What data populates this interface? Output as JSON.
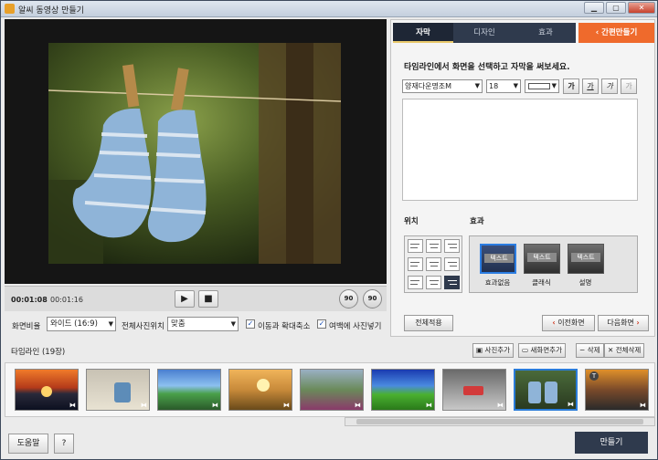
{
  "window": {
    "title": "알씨 동영상 만들기"
  },
  "controls": {
    "current_time": "00:01:08",
    "total_time": "00:01:16",
    "play": "▶",
    "stop": "■",
    "rotate_left": "90",
    "rotate_right": "90"
  },
  "options": {
    "ratio_label": "화면비율",
    "ratio_value": "와이드 (16:9)",
    "photo_pos_label": "전체사진위치",
    "photo_pos_value": "맞춤",
    "move_zoom_label": "이동과 확대축소",
    "margin_label": "여백에 사진넣기"
  },
  "panel": {
    "tabs": [
      "자막",
      "디자인",
      "효과"
    ],
    "quick_button": "간편만들기",
    "hint": "타임라인에서 화면을 선택하고 자막을 써보세요.",
    "font_value": "양재다운명조M",
    "size_value": "18",
    "style_buttons": [
      "가",
      "가",
      "가",
      "가"
    ],
    "position_label": "위치",
    "effect_label": "효과",
    "effects": [
      {
        "thumb": "텍스트",
        "label": "효과없음"
      },
      {
        "thumb": "텍스트",
        "label": "클래식"
      },
      {
        "thumb": "텍스트",
        "label": "설명"
      }
    ],
    "apply_all": "전체적용",
    "prev_scene": "이전화면",
    "next_scene": "다음화면"
  },
  "timeline": {
    "title": "타임라인 (19장)",
    "add_photo": "사진추가",
    "new_scene": "새화면추가",
    "delete": "삭제",
    "delete_all": "전체삭제"
  },
  "footer": {
    "help": "도움말",
    "question": "?",
    "make": "만들기"
  }
}
